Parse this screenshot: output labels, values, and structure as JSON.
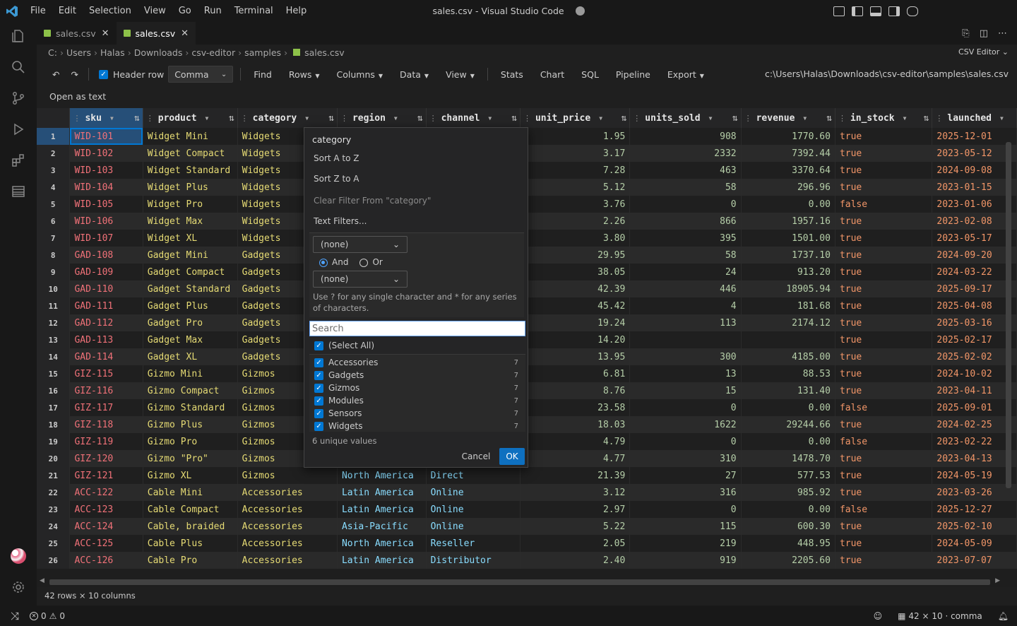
{
  "window": {
    "title": "sales.csv - Visual Studio Code",
    "menu": [
      "File",
      "Edit",
      "Selection",
      "View",
      "Go",
      "Run",
      "Terminal",
      "Help"
    ]
  },
  "tabs": [
    {
      "label": "sales.csv",
      "active": false
    },
    {
      "label": "sales.csv",
      "active": true
    }
  ],
  "breadcrumbs": [
    "C:",
    "Users",
    "Halas",
    "Downloads",
    "csv-editor",
    "samples",
    "sales.csv"
  ],
  "editor_mode": "CSV Editor",
  "toolbar": {
    "header_row_label": "Header row",
    "delimiter": "Comma",
    "buttons": [
      "Find",
      "Rows",
      "Columns",
      "Data",
      "View",
      "Stats",
      "Chart",
      "SQL",
      "Pipeline",
      "Export"
    ],
    "file_path": "c:\\Users\\Halas\\Downloads\\csv-editor\\samples\\sales.csv"
  },
  "open_as_text": "Open as text",
  "table": {
    "columns": [
      "sku",
      "product",
      "category",
      "region",
      "channel",
      "unit_price",
      "units_sold",
      "revenue",
      "in_stock",
      "launched"
    ],
    "rows": [
      [
        "1",
        "WID-101",
        "Widget Mini",
        "Widgets",
        "",
        "",
        "1.95",
        "908",
        "1770.60",
        "true",
        "2025-12-01"
      ],
      [
        "2",
        "WID-102",
        "Widget Compact",
        "Widgets",
        "",
        "",
        "3.17",
        "2332",
        "7392.44",
        "true",
        "2023-05-12"
      ],
      [
        "3",
        "WID-103",
        "Widget Standard",
        "Widgets",
        "",
        "",
        "7.28",
        "463",
        "3370.64",
        "true",
        "2024-09-08"
      ],
      [
        "4",
        "WID-104",
        "Widget Plus",
        "Widgets",
        "",
        "",
        "5.12",
        "58",
        "296.96",
        "true",
        "2023-01-15"
      ],
      [
        "5",
        "WID-105",
        "Widget Pro",
        "Widgets",
        "",
        "",
        "3.76",
        "0",
        "0.00",
        "false",
        "2023-01-06"
      ],
      [
        "6",
        "WID-106",
        "Widget Max",
        "Widgets",
        "",
        "",
        "2.26",
        "866",
        "1957.16",
        "true",
        "2023-02-08"
      ],
      [
        "7",
        "WID-107",
        "Widget XL",
        "Widgets",
        "",
        "",
        "3.80",
        "395",
        "1501.00",
        "true",
        "2023-05-17"
      ],
      [
        "8",
        "GAD-108",
        "Gadget Mini",
        "Gadgets",
        "",
        "",
        "29.95",
        "58",
        "1737.10",
        "true",
        "2024-09-20"
      ],
      [
        "9",
        "GAD-109",
        "Gadget Compact",
        "Gadgets",
        "",
        "",
        "38.05",
        "24",
        "913.20",
        "true",
        "2024-03-22"
      ],
      [
        "10",
        "GAD-110",
        "Gadget Standard",
        "Gadgets",
        "",
        "",
        "42.39",
        "446",
        "18905.94",
        "true",
        "2025-09-17"
      ],
      [
        "11",
        "GAD-111",
        "Gadget Plus",
        "Gadgets",
        "",
        "",
        "45.42",
        "4",
        "181.68",
        "true",
        "2025-04-08"
      ],
      [
        "12",
        "GAD-112",
        "Gadget Pro",
        "Gadgets",
        "",
        "",
        "19.24",
        "113",
        "2174.12",
        "true",
        "2025-03-16"
      ],
      [
        "13",
        "GAD-113",
        "Gadget Max",
        "Gadgets",
        "",
        "",
        "14.20",
        "",
        "",
        "true",
        "2025-02-17"
      ],
      [
        "14",
        "GAD-114",
        "Gadget XL",
        "Gadgets",
        "",
        "",
        "13.95",
        "300",
        "4185.00",
        "true",
        "2025-02-02"
      ],
      [
        "15",
        "GIZ-115",
        "Gizmo Mini",
        "Gizmos",
        "",
        "",
        "6.81",
        "13",
        "88.53",
        "true",
        "2024-10-02"
      ],
      [
        "16",
        "GIZ-116",
        "Gizmo Compact",
        "Gizmos",
        "",
        "",
        "8.76",
        "15",
        "131.40",
        "true",
        "2023-04-11"
      ],
      [
        "17",
        "GIZ-117",
        "Gizmo Standard",
        "Gizmos",
        "",
        "",
        "23.58",
        "0",
        "0.00",
        "false",
        "2025-09-01"
      ],
      [
        "18",
        "GIZ-118",
        "Gizmo Plus",
        "Gizmos",
        "",
        "",
        "18.03",
        "1622",
        "29244.66",
        "true",
        "2024-02-25"
      ],
      [
        "19",
        "GIZ-119",
        "Gizmo Pro",
        "Gizmos",
        "",
        "",
        "4.79",
        "0",
        "0.00",
        "false",
        "2023-02-22"
      ],
      [
        "20",
        "GIZ-120",
        "Gizmo \"Pro\"",
        "Gizmos",
        "",
        "",
        "4.77",
        "310",
        "1478.70",
        "true",
        "2023-04-13"
      ],
      [
        "21",
        "GIZ-121",
        "Gizmo XL",
        "Gizmos",
        "North America",
        "Direct",
        "21.39",
        "27",
        "577.53",
        "true",
        "2024-05-19"
      ],
      [
        "22",
        "ACC-122",
        "Cable Mini",
        "Accessories",
        "Latin America",
        "Online",
        "3.12",
        "316",
        "985.92",
        "true",
        "2023-03-26"
      ],
      [
        "23",
        "ACC-123",
        "Cable Compact",
        "Accessories",
        "Latin America",
        "Online",
        "2.97",
        "0",
        "0.00",
        "false",
        "2025-12-27"
      ],
      [
        "24",
        "ACC-124",
        "Cable, braided",
        "Accessories",
        "Asia-Pacific",
        "Online",
        "5.22",
        "115",
        "600.30",
        "true",
        "2025-02-10"
      ],
      [
        "25",
        "ACC-125",
        "Cable Plus",
        "Accessories",
        "North America",
        "Reseller",
        "2.05",
        "219",
        "448.95",
        "true",
        "2024-05-09"
      ],
      [
        "26",
        "ACC-126",
        "Cable Pro",
        "Accessories",
        "Latin America",
        "Distributor",
        "2.40",
        "919",
        "2205.60",
        "true",
        "2023-07-07"
      ]
    ]
  },
  "row_info": "42 rows × 10 columns",
  "filter_popup": {
    "title": "category",
    "sort_asc": "Sort A to Z",
    "sort_desc": "Sort Z to A",
    "clear_filter": "Clear Filter From \"category\"",
    "text_filters": "Text Filters...",
    "condition1": "(none)",
    "condition2": "(none)",
    "and_label": "And",
    "or_label": "Or",
    "hint": "Use ? for any single character and * for any series of characters.",
    "search_placeholder": "Search",
    "select_all": "(Select All)",
    "values": [
      {
        "label": "Accessories",
        "count": "7"
      },
      {
        "label": "Gadgets",
        "count": "7"
      },
      {
        "label": "Gizmos",
        "count": "7"
      },
      {
        "label": "Modules",
        "count": "7"
      },
      {
        "label": "Sensors",
        "count": "7"
      },
      {
        "label": "Widgets",
        "count": "7"
      }
    ],
    "unique_values": "6 unique values",
    "cancel": "Cancel",
    "ok": "OK"
  },
  "status": {
    "errors": "0",
    "warnings": "0",
    "grid_info": "42 × 10 · comma"
  },
  "colors": {
    "accent": "#0078d4",
    "selected_header": "#264f78"
  }
}
